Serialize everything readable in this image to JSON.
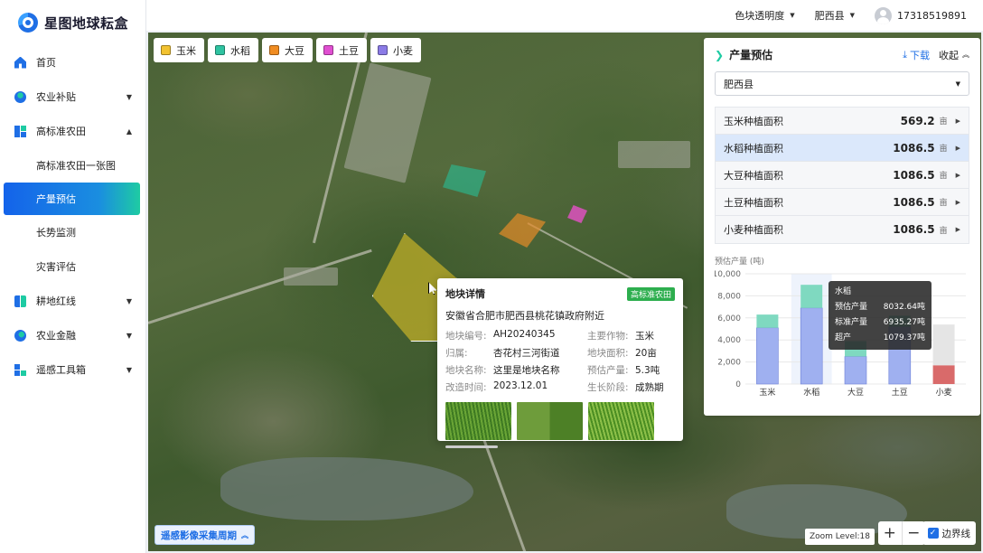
{
  "app": {
    "title": "星图地球耘盒"
  },
  "sidebar": {
    "items": [
      {
        "label": "首页",
        "icon": "home-icon"
      },
      {
        "label": "农业补贴",
        "icon": "subsidy-icon"
      },
      {
        "label": "高标准农田",
        "icon": "grid-icon"
      },
      {
        "label": "高标准农田一张图"
      },
      {
        "label": "产量预估"
      },
      {
        "label": "长势监测"
      },
      {
        "label": "灾害评估"
      },
      {
        "label": "耕地红线",
        "icon": "book-icon"
      },
      {
        "label": "农业金融",
        "icon": "finance-icon"
      },
      {
        "label": "遥感工具箱",
        "icon": "toolbox-icon"
      }
    ]
  },
  "header": {
    "opacity_label": "色块透明度",
    "county_label": "肥西县",
    "user_phone": "17318519891"
  },
  "legend": [
    {
      "label": "玉米",
      "color": "#f2c230"
    },
    {
      "label": "水稻",
      "color": "#2fc3a1"
    },
    {
      "label": "大豆",
      "color": "#f08c22"
    },
    {
      "label": "土豆",
      "color": "#e04fd1"
    },
    {
      "label": "小麦",
      "color": "#8b7be6"
    }
  ],
  "popup": {
    "title": "地块详情",
    "badge": "高标准农田",
    "address": "安徽省合肥市肥西县桃花镇政府附近",
    "fields": [
      {
        "k": "地块编号:",
        "v": "AH20240345"
      },
      {
        "k": "主要作物:",
        "v": "玉米"
      },
      {
        "k": "归属:",
        "v": "杏花村三河街道"
      },
      {
        "k": "地块面积:",
        "v": "20亩"
      },
      {
        "k": "地块名称:",
        "v": "这里是地块名称"
      },
      {
        "k": "预估产量:",
        "v": "5.3吨"
      },
      {
        "k": "改造时间:",
        "v": "2023.12.01"
      },
      {
        "k": "生长阶段:",
        "v": "成熟期"
      }
    ]
  },
  "panel": {
    "title": "产量预估",
    "download": "下载",
    "collapse": "收起",
    "select_value": "肥西县",
    "stats": [
      {
        "label": "玉米种植面积",
        "value": "569.2",
        "unit": "亩"
      },
      {
        "label": "水稻种植面积",
        "value": "1086.5",
        "unit": "亩"
      },
      {
        "label": "大豆种植面积",
        "value": "1086.5",
        "unit": "亩"
      },
      {
        "label": "土豆种植面积",
        "value": "1086.5",
        "unit": "亩"
      },
      {
        "label": "小麦种植面积",
        "value": "1086.5",
        "unit": "亩"
      }
    ],
    "chart_label": "预估产量 (吨)",
    "tooltip": {
      "title": "水稻",
      "rows": [
        {
          "k": "预估产量",
          "v": "8032.64吨"
        },
        {
          "k": "标准产量",
          "v": "6935.27吨"
        },
        {
          "k": "超产",
          "v": "1079.37吨"
        }
      ]
    }
  },
  "chart_data": {
    "type": "bar",
    "categories": [
      "玉米",
      "水稻",
      "大豆",
      "土豆",
      "小麦"
    ],
    "ylim": [
      0,
      10000
    ],
    "yticks": [
      "0",
      "2,000",
      "4,000",
      "6,000",
      "8,000",
      "10,000"
    ],
    "series": [
      {
        "values": [
          5100,
          6900,
          2500,
          5200,
          0
        ],
        "color": "#9fb0f0"
      },
      {
        "values": [
          1200,
          2100,
          1400,
          1000,
          0
        ],
        "color": "#7fd9c0"
      },
      {
        "values": [
          0,
          0,
          0,
          0,
          1700
        ],
        "color": "#d96a6a"
      },
      {
        "values": [
          0,
          0,
          0,
          0,
          3700
        ],
        "color": "#e5e5e5"
      }
    ]
  },
  "map": {
    "period_btn": "遥感影像采集周期",
    "zoom_level": "Zoom Level:18",
    "boundary_label": "边界线"
  }
}
